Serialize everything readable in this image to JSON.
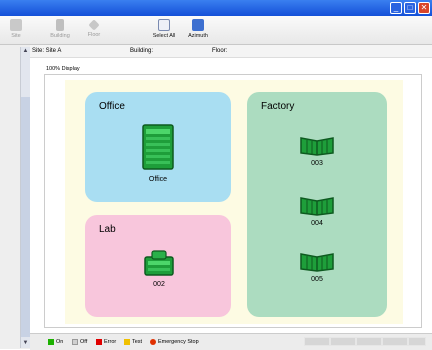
{
  "window": {
    "controls": [
      "minimize",
      "maximize",
      "close"
    ]
  },
  "toolbar": {
    "items": [
      {
        "label": "Site",
        "icon": "building-icon"
      },
      {
        "label": "Building",
        "icon": "server-icon"
      },
      {
        "label": "Floor",
        "icon": "diamond-icon"
      },
      {
        "label": "Select All",
        "icon": "select-all-icon"
      },
      {
        "label": "Azimuth",
        "icon": "azimuth-icon"
      }
    ]
  },
  "info": {
    "site": "Site: Site A",
    "building": "Building:",
    "floor": "Floor:"
  },
  "view": {
    "label": "100% Display"
  },
  "rooms": {
    "office": {
      "title": "Office",
      "device": "Office"
    },
    "lab": {
      "title": "Lab",
      "device": "002"
    },
    "factory": {
      "title": "Factory",
      "devices": [
        "003",
        "004",
        "005"
      ]
    }
  },
  "legend": [
    {
      "label": "On",
      "color": "#1cb000"
    },
    {
      "label": "Off",
      "color": "#d0d0d0"
    },
    {
      "label": "Error",
      "color": "#e00000"
    },
    {
      "label": "Test",
      "color": "#f0c000"
    },
    {
      "label": "Emergency Stop",
      "color": "#e03000"
    }
  ],
  "colors": {
    "office_bg": "#a9def2",
    "lab_bg": "#f8c6dc",
    "factory_bg": "#acdcc0",
    "device_green": "#22b14c"
  }
}
